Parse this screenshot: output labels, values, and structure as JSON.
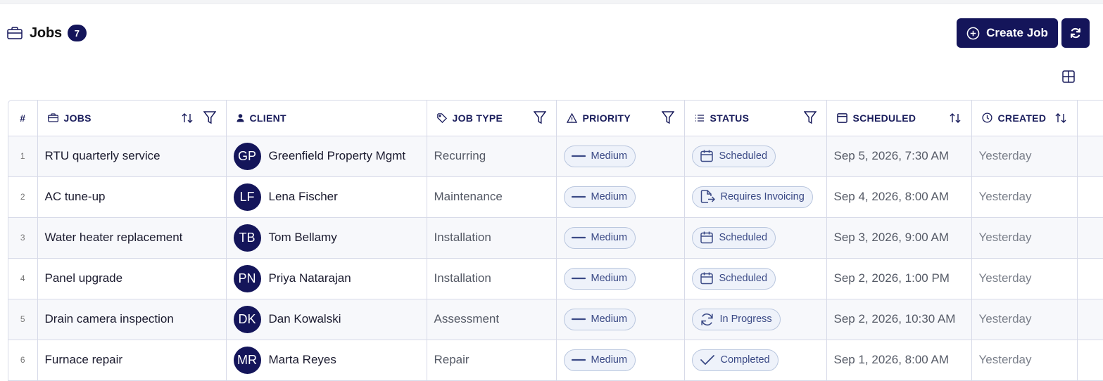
{
  "header": {
    "title": "Jobs",
    "count": "7"
  },
  "actions": {
    "create_label": "Create Job"
  },
  "table": {
    "columns": {
      "num": "#",
      "jobs": "JOBS",
      "client": "CLIENT",
      "job_type": "JOB TYPE",
      "priority": "PRIORITY",
      "status": "STATUS",
      "scheduled": "SCHEDULED",
      "created": "CREATED"
    },
    "rows": [
      {
        "num": "1",
        "job": "RTU quarterly service",
        "initials": "GP",
        "client": "Greenfield Property Mgmt",
        "type": "Recurring",
        "priority": "Medium",
        "status": "Scheduled",
        "status_icon": "calendar-icon",
        "scheduled": "Sep 5, 2026, 7:30 AM",
        "created": "Yesterday"
      },
      {
        "num": "2",
        "job": "AC tune-up",
        "initials": "LF",
        "client": "Lena Fischer",
        "type": "Maintenance",
        "priority": "Medium",
        "status": "Requires Invoicing",
        "status_icon": "invoice-icon",
        "scheduled": "Sep 4, 2026, 8:00 AM",
        "created": "Yesterday"
      },
      {
        "num": "3",
        "job": "Water heater replacement",
        "initials": "TB",
        "client": "Tom Bellamy",
        "type": "Installation",
        "priority": "Medium",
        "status": "Scheduled",
        "status_icon": "calendar-icon",
        "scheduled": "Sep 3, 2026, 9:00 AM",
        "created": "Yesterday"
      },
      {
        "num": "4",
        "job": "Panel upgrade",
        "initials": "PN",
        "client": "Priya Natarajan",
        "type": "Installation",
        "priority": "Medium",
        "status": "Scheduled",
        "status_icon": "calendar-icon",
        "scheduled": "Sep 2, 2026, 1:00 PM",
        "created": "Yesterday"
      },
      {
        "num": "5",
        "job": "Drain camera inspection",
        "initials": "DK",
        "client": "Dan Kowalski",
        "type": "Assessment",
        "priority": "Medium",
        "status": "In Progress",
        "status_icon": "refresh-icon",
        "scheduled": "Sep 2, 2026, 10:30 AM",
        "created": "Yesterday"
      },
      {
        "num": "6",
        "job": "Furnace repair",
        "initials": "MR",
        "client": "Marta Reyes",
        "type": "Repair",
        "priority": "Medium",
        "status": "Completed",
        "status_icon": "check-icon",
        "scheduled": "Sep 1, 2026, 8:00 AM",
        "created": "Yesterday"
      }
    ]
  },
  "colors": {
    "brand": "#14155a",
    "pill_bg": "#eef2fa",
    "pill_border": "#b9c6de",
    "pill_text": "#3b4a86"
  }
}
